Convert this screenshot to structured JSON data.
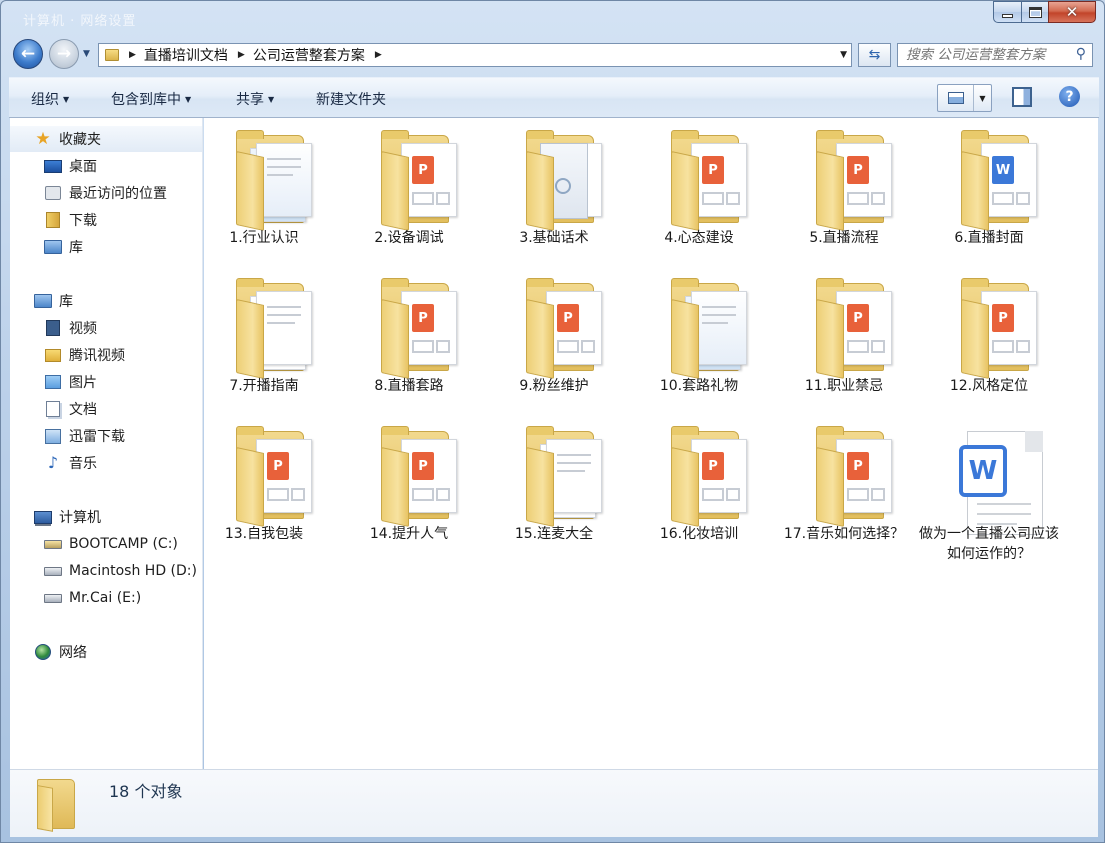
{
  "window": {
    "ghost_title": "计算机  ·  网络设置"
  },
  "address": {
    "crumbs": [
      "直播培训文档",
      "公司运营整套方案"
    ]
  },
  "search": {
    "placeholder": "搜索 公司运营整套方案"
  },
  "toolbar": {
    "organize": "组织",
    "include": "包含到库中",
    "share": "共享",
    "new_folder": "新建文件夹"
  },
  "sidebar": {
    "favorites": {
      "label": "收藏夹",
      "items": [
        "桌面",
        "最近访问的位置",
        "下载",
        "库"
      ]
    },
    "libraries": {
      "label": "库",
      "items": [
        "视频",
        "腾讯视频",
        "图片",
        "文档",
        "迅雷下载",
        "音乐"
      ]
    },
    "computer": {
      "label": "计算机",
      "items": [
        "BOOTCAMP (C:)",
        "Macintosh HD (D:)",
        "Mr.Cai (E:)"
      ]
    },
    "network": {
      "label": "网络"
    }
  },
  "files": [
    {
      "name": "1.行业认识",
      "type": "folder-doc"
    },
    {
      "name": "2.设备调试",
      "type": "folder-ppt"
    },
    {
      "name": "3.基础话术",
      "type": "folder-cover"
    },
    {
      "name": "4.心态建设",
      "type": "folder-ppt"
    },
    {
      "name": "5.直播流程",
      "type": "folder-ppt"
    },
    {
      "name": "6.直播封面",
      "type": "folder-word"
    },
    {
      "name": "7.开播指南",
      "type": "folder-plain"
    },
    {
      "name": "8.直播套路",
      "type": "folder-ppt"
    },
    {
      "name": "9.粉丝维护",
      "type": "folder-ppt"
    },
    {
      "name": "10.套路礼物",
      "type": "folder-doc"
    },
    {
      "name": "11.职业禁忌",
      "type": "folder-ppt"
    },
    {
      "name": "12.风格定位",
      "type": "folder-ppt"
    },
    {
      "name": "13.自我包装",
      "type": "folder-ppt"
    },
    {
      "name": "14.提升人气",
      "type": "folder-ppt"
    },
    {
      "name": "15.连麦大全",
      "type": "folder-plain"
    },
    {
      "name": "16.化妆培训",
      "type": "folder-ppt"
    },
    {
      "name": "17.音乐如何选择？",
      "type": "folder-ppt"
    },
    {
      "name": "做为一个直播公司应该如何运作的？",
      "type": "word-file"
    }
  ],
  "ppt_glyph": "P",
  "word_glyph": "W",
  "status": {
    "count": "18 个对象"
  },
  "colors": {
    "ppt": "#e8613a",
    "word": "#3b78d8",
    "folder": "#e3bf5e"
  }
}
